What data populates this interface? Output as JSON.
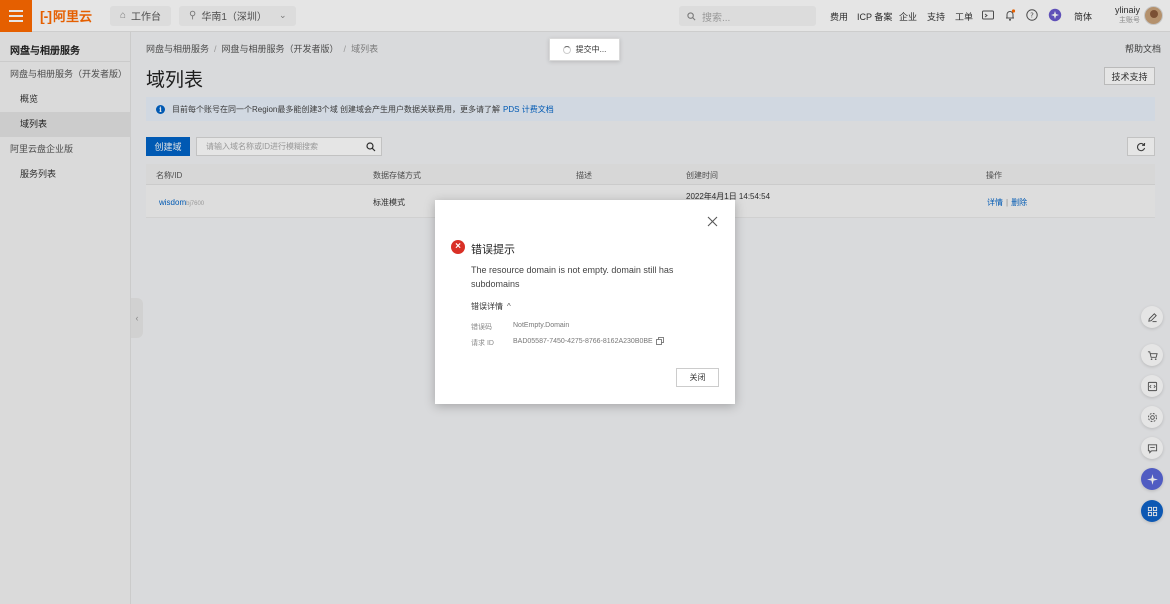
{
  "topbar": {
    "logo_text": "阿里云",
    "workbench_label": "工作台",
    "region_label": "华南1（深圳）",
    "search_placeholder": "搜索...",
    "links": [
      "费用",
      "ICP 备案",
      "企业",
      "支持",
      "工单"
    ],
    "lang_label": "简体",
    "user_name": "ylinaiy",
    "user_role": "主账号"
  },
  "sidebar": {
    "title": "网盘与相册服务",
    "items": [
      {
        "label": "网盘与相册服务（开发者版）",
        "kind": "group"
      },
      {
        "label": "概览",
        "kind": "sub"
      },
      {
        "label": "域列表",
        "kind": "sub",
        "active": true
      },
      {
        "label": "阿里云盘企业版",
        "kind": "group"
      },
      {
        "label": "服务列表",
        "kind": "sub"
      }
    ]
  },
  "breadcrumb": [
    "网盘与相册服务",
    "网盘与相册服务（开发者版）",
    "域列表"
  ],
  "help_link": "帮助文档",
  "page_title": "域列表",
  "tech_support_label": "技术支持",
  "notice": {
    "text": "目前每个账号在同一个Region最多能创建3个域 创建域会产生用户数据关联费用，更多请了解",
    "link": "PDS 计费文档"
  },
  "toolbar": {
    "create_label": "创建域",
    "search_placeholder": "请输入域名称或ID进行模糊搜索"
  },
  "table": {
    "headers": [
      "名称/ID",
      "数据存储方式",
      "描述",
      "创建时间",
      "操作"
    ],
    "rows": [
      {
        "name": "wisdom",
        "id": "bj7600",
        "storage": "标准模式",
        "desc": "",
        "created": "2022年4月1日 14:54:54",
        "action_detail": "详情",
        "action_delete": "删除"
      }
    ]
  },
  "toast": {
    "text": "提交中..."
  },
  "dialog": {
    "title": "错误提示",
    "message": "The resource domain is not empty. domain still has subdomains",
    "detail_toggle": "错误详情",
    "error_code_label": "错误码",
    "error_code": "NotEmpty.Domain",
    "request_id_label": "请求 ID",
    "request_id": "BAD05587-7450-4275-8766-8162A230B0BE",
    "close_label": "关闭"
  },
  "icons": {
    "float_tools": [
      "edit-icon",
      "cart-icon",
      "code-icon",
      "settings-icon",
      "message-icon",
      "ai-assistant-icon",
      "apps-icon"
    ]
  },
  "colors": {
    "brand": "#ff6a00",
    "primary": "#0064c8",
    "error": "#d93026"
  }
}
